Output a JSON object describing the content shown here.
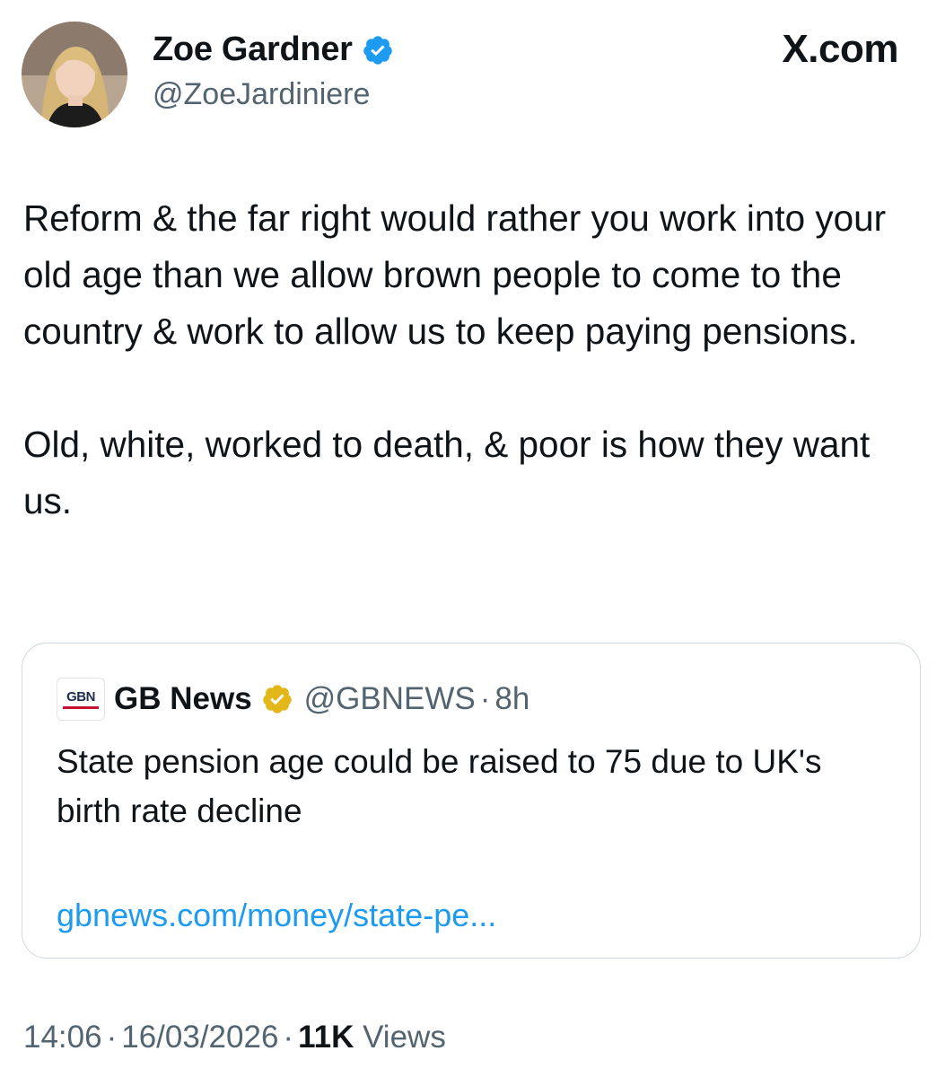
{
  "author": {
    "display_name": "Zoe Gardner",
    "handle": "@ZoeJardiniere",
    "verified": true,
    "verified_color": "#1d9bf0",
    "avatar_icon": "profile-photo"
  },
  "brand": "X.com",
  "tweet": {
    "paragraphs": [
      "Reform & the far right would rather you work into your old age than we allow brown people to come to the country & work to allow us to keep paying pensions.",
      "Old, white, worked to death, & poor is how they want us."
    ]
  },
  "quoted_tweet": {
    "logo_text": "GBN",
    "display_name": "GB News",
    "verified": true,
    "verified_color": "#e2b719",
    "handle": "@GBNEWS",
    "separator": "·",
    "time": "8h",
    "text": "State pension age could be raised to 75 due to UK's birth rate decline",
    "link": "gbnews.com/money/state-pe..."
  },
  "meta": {
    "time": "14:06",
    "separator": "·",
    "date": "16/03/2026",
    "views_count": "11K",
    "views_label": "Views"
  },
  "colors": {
    "text_primary": "#0f1419",
    "text_secondary": "#536471",
    "link": "#1d9bf0",
    "border": "#cfd9de"
  }
}
